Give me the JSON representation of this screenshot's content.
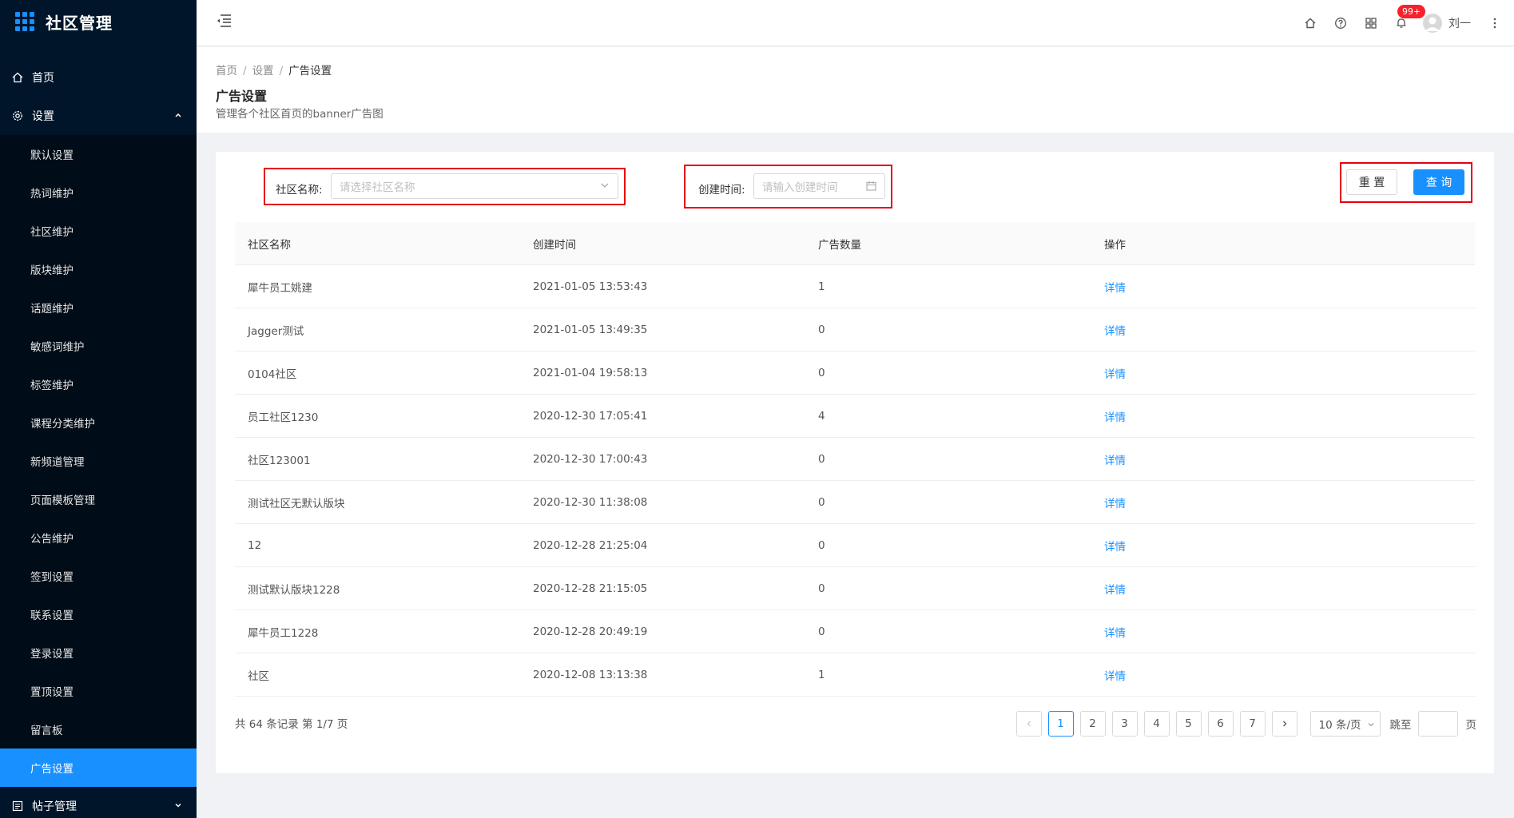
{
  "app": {
    "title": "社区管理"
  },
  "sidebar": {
    "home": "首页",
    "settings": "设置",
    "settings_items": [
      "默认设置",
      "热词维护",
      "社区维护",
      "版块维护",
      "话题维护",
      "敏感词维护",
      "标签维护",
      "课程分类维护",
      "新频道管理",
      "页面模板管理",
      "公告维护",
      "签到设置",
      "联系设置",
      "登录设置",
      "置顶设置",
      "留言板",
      "广告设置"
    ],
    "active_index": 16,
    "post_management": "帖子管理"
  },
  "header": {
    "badge": "99+",
    "user_name": "刘一"
  },
  "breadcrumb": {
    "home": "首页",
    "settings": "设置",
    "current": "广告设置"
  },
  "page": {
    "title": "广告设置",
    "description": "管理各个社区首页的banner广告图"
  },
  "filters": {
    "community_label": "社区名称:",
    "community_placeholder": "请选择社区名称",
    "time_label": "创建时间:",
    "time_placeholder": "请输入创建时间",
    "reset": "重 置",
    "query": "查 询"
  },
  "table": {
    "headers": [
      "社区名称",
      "创建时间",
      "广告数量",
      "操作"
    ],
    "rows": [
      {
        "name": "犀牛员工姚建",
        "time": "2021-01-05 13:53:43",
        "count": "1",
        "action": "详情"
      },
      {
        "name": "Jagger测试",
        "time": "2021-01-05 13:49:35",
        "count": "0",
        "action": "详情"
      },
      {
        "name": "0104社区",
        "time": "2021-01-04 19:58:13",
        "count": "0",
        "action": "详情"
      },
      {
        "name": "员工社区1230",
        "time": "2020-12-30 17:05:41",
        "count": "4",
        "action": "详情"
      },
      {
        "name": "社区123001",
        "time": "2020-12-30 17:00:43",
        "count": "0",
        "action": "详情"
      },
      {
        "name": "测试社区无默认版块",
        "time": "2020-12-30 11:38:08",
        "count": "0",
        "action": "详情"
      },
      {
        "name": "12",
        "time": "2020-12-28 21:25:04",
        "count": "0",
        "action": "详情"
      },
      {
        "name": "测试默认版块1228",
        "time": "2020-12-28 21:15:05",
        "count": "0",
        "action": "详情"
      },
      {
        "name": "犀牛员工1228",
        "time": "2020-12-28 20:49:19",
        "count": "0",
        "action": "详情"
      },
      {
        "name": "社区",
        "time": "2020-12-08 13:13:38",
        "count": "1",
        "action": "详情"
      }
    ]
  },
  "pagination": {
    "summary": "共 64 条记录 第 1/7 页",
    "pages": [
      "1",
      "2",
      "3",
      "4",
      "5",
      "6",
      "7"
    ],
    "current": "1",
    "page_size": "10 条/页",
    "jump_label": "跳至",
    "jump_unit": "页"
  }
}
